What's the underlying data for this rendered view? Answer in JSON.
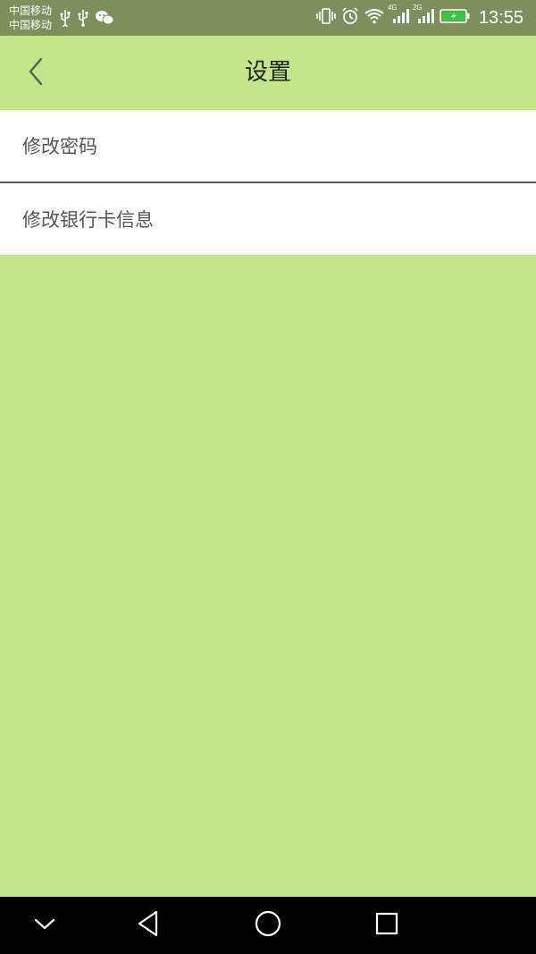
{
  "status_bar": {
    "carrier_1": "中国移动",
    "carrier_2": "中国移动",
    "time": "13:55",
    "network_1": "4G",
    "network_2": "2G",
    "icons": [
      "usb-icon",
      "usb-icon",
      "wechat-icon",
      "vibrate-icon",
      "alarm-icon",
      "wifi-icon",
      "signal-icon",
      "signal-icon",
      "battery-charging-icon"
    ],
    "battery_color": "#2ecc40"
  },
  "header": {
    "title": "设置",
    "back_icon": "chevron-left-icon"
  },
  "menu": {
    "items": [
      {
        "label": "修改密码"
      },
      {
        "label": "修改银行卡信息"
      }
    ]
  },
  "nav_bar": {
    "icons": [
      "chevron-down-icon",
      "back-triangle-icon",
      "home-circle-icon",
      "recents-square-icon"
    ]
  },
  "colors": {
    "background": "#c4e589",
    "status_bar": "#7c8f5d",
    "nav_bar": "#000000"
  }
}
